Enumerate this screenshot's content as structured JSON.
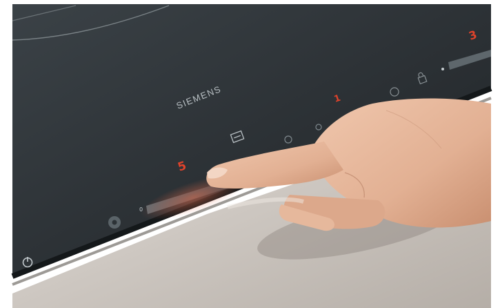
{
  "brand": "SIEMENS",
  "zone_levels": {
    "front_left": "5",
    "rear_center": "1",
    "rear_right": "3"
  },
  "slider_min_glyph": "0",
  "colors": {
    "glass": "#2c3236",
    "glass_light": "#3f474c",
    "steel": "#c9c3bd",
    "display_red": "#e0432b",
    "legend_gray": "#b9c0c4",
    "skin": "#e7b79a"
  },
  "icons": [
    "power-icon",
    "timer-icon",
    "cook-zone-select-icon",
    "lock-icon",
    "wipe-protection-icon"
  ]
}
